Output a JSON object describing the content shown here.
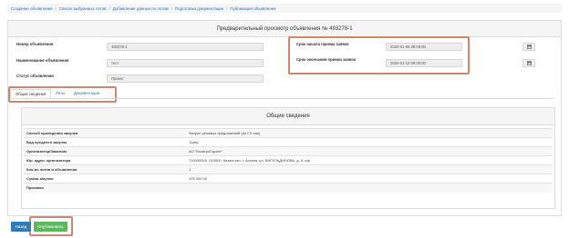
{
  "breadcrumb": [
    "Создание объявления",
    "Список выбранных лотов",
    "Добавление данных по лотам",
    "Подготовка документации",
    "Публикация объявления"
  ],
  "page_title": "Предварительный просмотр объявления № 493278-1",
  "fields": {
    "number_label": "Номер объявления",
    "number_value": "493278-1",
    "name_label": "Наименование объявления",
    "name_value": "тест",
    "status_label": "Статус объявления",
    "status_value": "Проект",
    "start_label": "Срок начала приема заявок",
    "start_value": "2020-01-06 09:00:00",
    "end_label": "Срок окончания приема заявок",
    "end_value": "2020-01-13 09:00:00"
  },
  "tabs": [
    "Общие сведения",
    "Лоты",
    "Документация"
  ],
  "general": {
    "title": "Общие сведения",
    "rows": [
      {
        "k": "Способ проведения закупки",
        "v": "Запрос ценовых предложений (не ГЗ том)"
      },
      {
        "k": "Вид предмета закупок",
        "v": "Товар"
      },
      {
        "k": "Организатор/Заказчик",
        "v": "АО \"КазАгроГарант\""
      },
      {
        "k": "Юр. адрес организатора",
        "v": "710000000, 010000, Казахстан, г. Астана, ул. БИГЕЛЬДИНОВА, д. 6, оф"
      },
      {
        "k": "Кол-во лотов в объявлении",
        "v": "1"
      },
      {
        "k": "Сумма закупки",
        "v": "105 000.00"
      },
      {
        "k": "Признаки",
        "v": ""
      }
    ]
  },
  "buttons": {
    "back": "Назад",
    "publish": "Опубликовать"
  },
  "colors": {
    "highlight": "#c98a73",
    "primary": "#337ab7",
    "success": "#5cb85c",
    "link": "#2a6fb6"
  },
  "icons": {
    "date_picker": "calendar-icon"
  }
}
